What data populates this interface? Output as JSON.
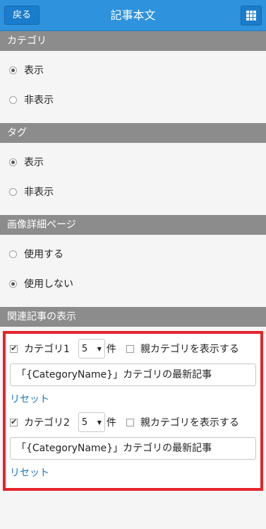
{
  "header": {
    "back_label": "戻る",
    "title": "記事本文",
    "grid_icon": "grid-icon"
  },
  "sections": {
    "category": {
      "title": "カテゴリ",
      "options": [
        "表示",
        "非表示"
      ],
      "selected": 0
    },
    "tag": {
      "title": "タグ",
      "options": [
        "表示",
        "非表示"
      ],
      "selected": 0
    },
    "image_detail": {
      "title": "画像詳細ページ",
      "options": [
        "使用する",
        "使用しない"
      ],
      "selected": 1
    },
    "related": {
      "title": "関連記事の表示",
      "items": [
        {
          "label": "カテゴリ1",
          "checked": true,
          "count": "5",
          "count_unit": "件",
          "parent_label": "親カテゴリを表示する",
          "parent_checked": false,
          "title_value": "「{CategoryName}」カテゴリの最新記事",
          "reset_label": "リセット"
        },
        {
          "label": "カテゴリ2",
          "checked": true,
          "count": "5",
          "count_unit": "件",
          "parent_label": "親カテゴリを表示する",
          "parent_checked": false,
          "title_value": "「{CategoryName}」カテゴリの最新記事",
          "reset_label": "リセット"
        }
      ]
    }
  }
}
